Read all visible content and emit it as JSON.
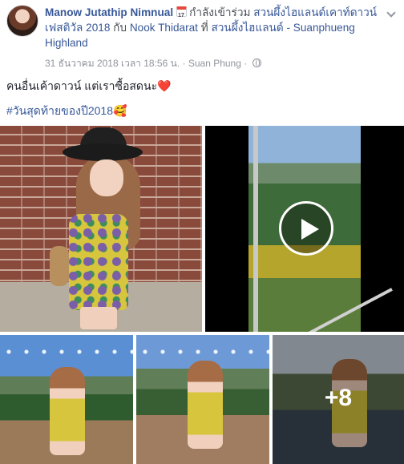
{
  "header": {
    "author": "Manow Jutathip Nimnual",
    "activity_icon": "calendar-icon",
    "activity_text": "กำลังเข้าร่วม",
    "event_link": "สวนผึ้งไฮแลนด์เคาท์ดาวน์ เฟสติวัล 2018",
    "with_text": "กับ",
    "tagged_user": "Nook Thidarat",
    "at_text": "ที่",
    "place": "สวนผึ้งไฮแลนด์ - Suanphueng Highland",
    "timestamp": "31 ธันวาคม 2018 เวลา 18:56 น.",
    "separator": "·",
    "location": "Suan Phung",
    "privacy_icon": "globe-icon"
  },
  "post": {
    "text": "คนอื่นเค้าดาวน์ แต่เราซื้อสดนะ",
    "emoji": "❤️",
    "hashtag": "#วันสุดท้ายของปี2018",
    "hashtag_emoji": "🥰"
  },
  "photos": {
    "more_count": "+8"
  }
}
